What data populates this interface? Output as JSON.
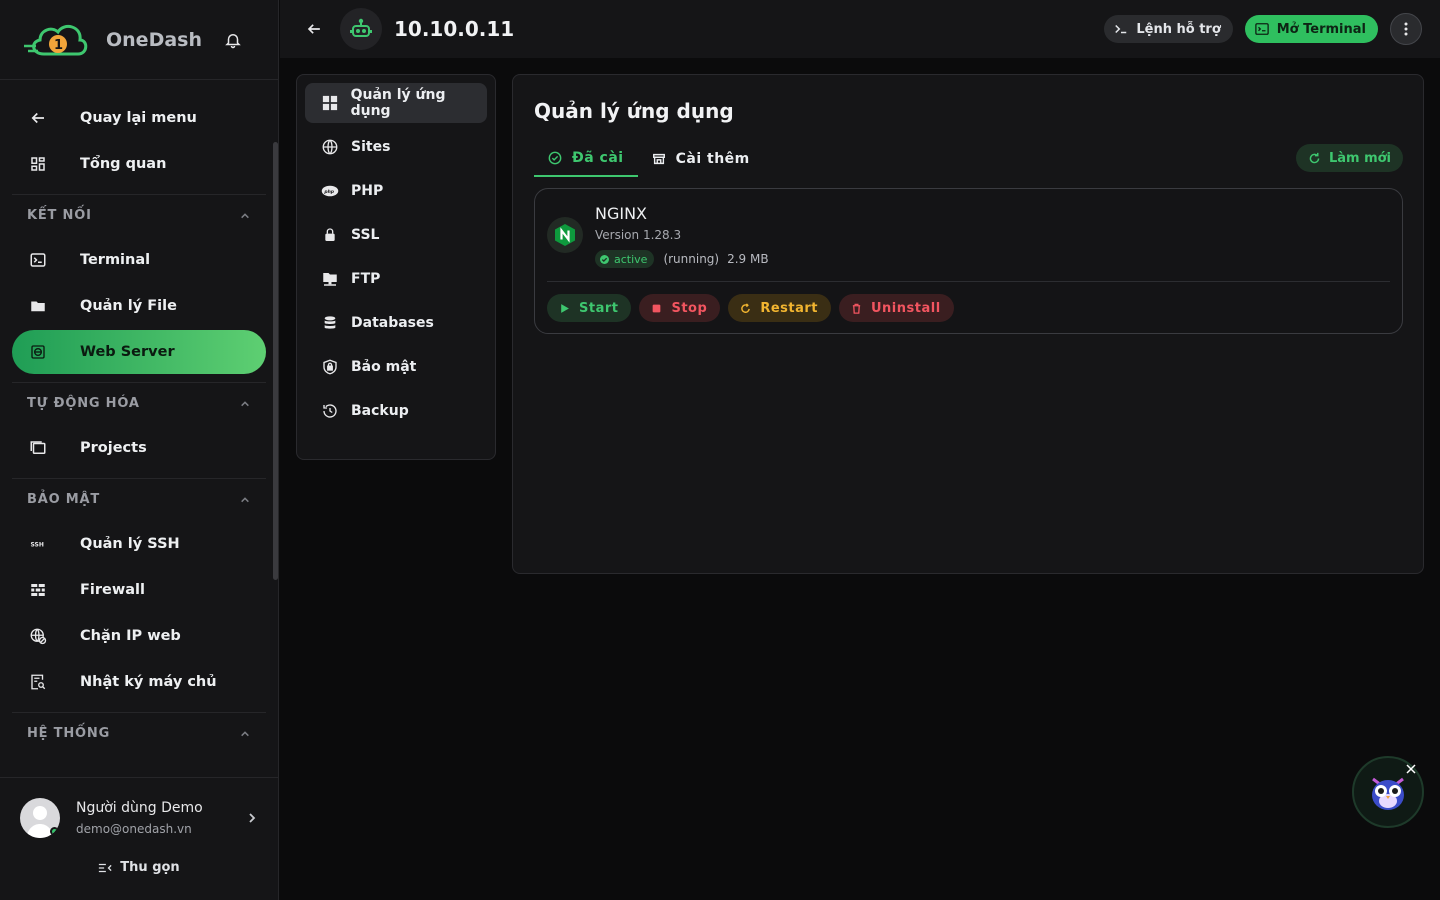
{
  "brand": {
    "name": "OneDash"
  },
  "nav": {
    "back": "Quay lại menu",
    "overview": "Tổng quan",
    "sections": [
      {
        "title": "KẾT NỐI",
        "items": [
          "Terminal",
          "Quản lý File",
          "Web Server"
        ]
      },
      {
        "title": "TỰ ĐỘNG HÓA",
        "items": [
          "Projects"
        ]
      },
      {
        "title": "BẢO MẬT",
        "items": [
          "Quản lý SSH",
          "Firewall",
          "Chặn IP web",
          "Nhật ký máy chủ"
        ]
      },
      {
        "title": "HỆ THỐNG",
        "items": []
      }
    ],
    "active": "Web Server"
  },
  "user": {
    "name": "Người dùng Demo",
    "email": "demo@onedash.vn"
  },
  "collapse_label": "Thu gọn",
  "topbar": {
    "host": "10.10.0.11",
    "help_label": "Lệnh hỗ trợ",
    "terminal_label": "Mở Terminal"
  },
  "submenu": {
    "items": [
      "Quản lý ứng dụng",
      "Sites",
      "PHP",
      "SSL",
      "FTP",
      "Databases",
      "Bảo mật",
      "Backup"
    ],
    "active": "Quản lý ứng dụng"
  },
  "panel": {
    "title": "Quản lý ứng dụng",
    "tabs": [
      "Đã cài",
      "Cài thêm"
    ],
    "active_tab": "Đã cài",
    "refresh_label": "Làm mới"
  },
  "app": {
    "name": "NGINX",
    "version": "Version 1.28.3",
    "status": "active",
    "state": "(running)",
    "size": "2.9 MB",
    "actions": {
      "start": "Start",
      "stop": "Stop",
      "restart": "Restart",
      "uninstall": "Uninstall"
    }
  },
  "colors": {
    "accent": "#3ec76f",
    "danger": "#f25560",
    "warning": "#f2b530",
    "background": "#0b0b0c",
    "surface": "#151517"
  }
}
